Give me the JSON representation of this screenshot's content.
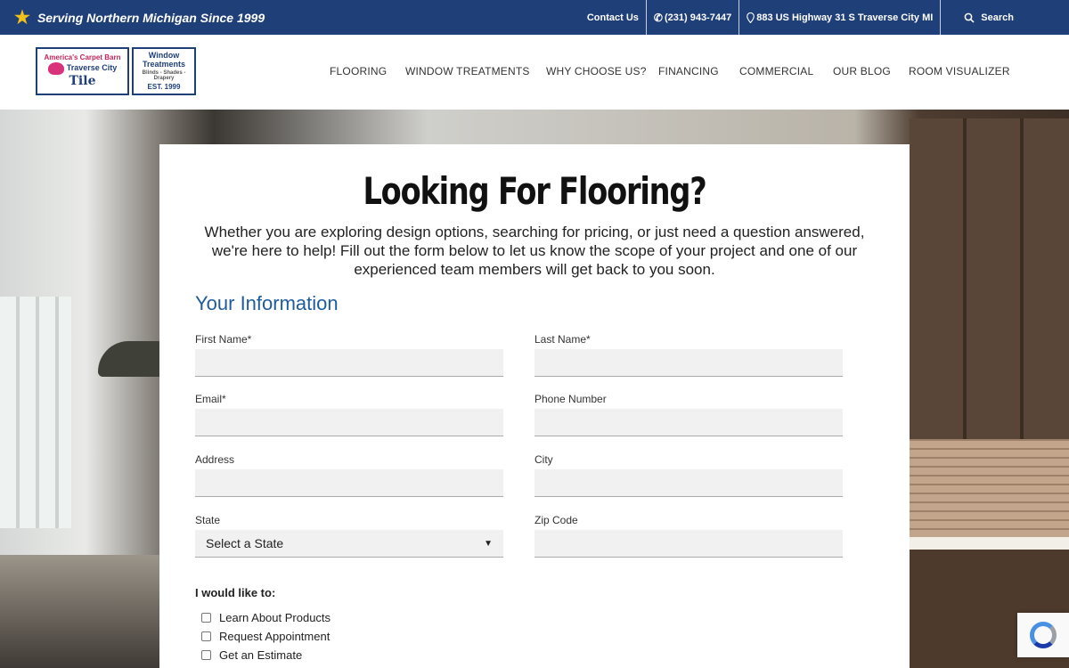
{
  "topbar": {
    "tagline": "Serving Northern Michigan Since 1999",
    "contact": "Contact Us",
    "phone": "(231) 943-7447",
    "address": "883 US Highway 31 S Traverse City MI",
    "search": "Search"
  },
  "logo": {
    "left_line1": "America's Carpet Barn",
    "left_line2": "Traverse City",
    "left_line3": "Tile",
    "right_line1": "Window",
    "right_line2": "Treatments",
    "right_line3": "Blinds - Shades - Drapery",
    "right_line4": "EST. 1999"
  },
  "nav": {
    "items": [
      "FLOORING",
      "WINDOW TREATMENTS",
      "WHY CHOOSE US?",
      "FINANCING",
      "COMMERCIAL",
      "OUR BLOG",
      "ROOM VISUALIZER"
    ]
  },
  "form": {
    "title": "Looking For Flooring?",
    "intro": "Whether you are exploring design options, searching for pricing, or just need a question answered, we're here to help! Fill out the form below to let us know the scope of your project and one of our experienced team members will get back to you soon.",
    "section_title": "Your Information",
    "labels": {
      "first_name": "First Name*",
      "last_name": "Last Name*",
      "email": "Email*",
      "phone": "Phone Number",
      "address": "Address",
      "city": "City",
      "state": "State",
      "zip": "Zip Code"
    },
    "values": {
      "first_name": "",
      "last_name": "",
      "email": "",
      "phone": "",
      "address": "",
      "city": "",
      "zip": ""
    },
    "state_selected": "Select a State",
    "would_like_label": "I would like to:",
    "options": [
      "Learn About Products",
      "Request Appointment",
      "Get an Estimate"
    ]
  },
  "colors": {
    "brand_blue": "#1f3f78",
    "accent_blue": "#1f5c9c",
    "star": "#f2c21b"
  },
  "icons": {
    "star": "star-icon",
    "phone": "phone-icon",
    "location": "map-pin-icon",
    "search": "search-icon",
    "recaptcha": "recaptcha-icon"
  }
}
